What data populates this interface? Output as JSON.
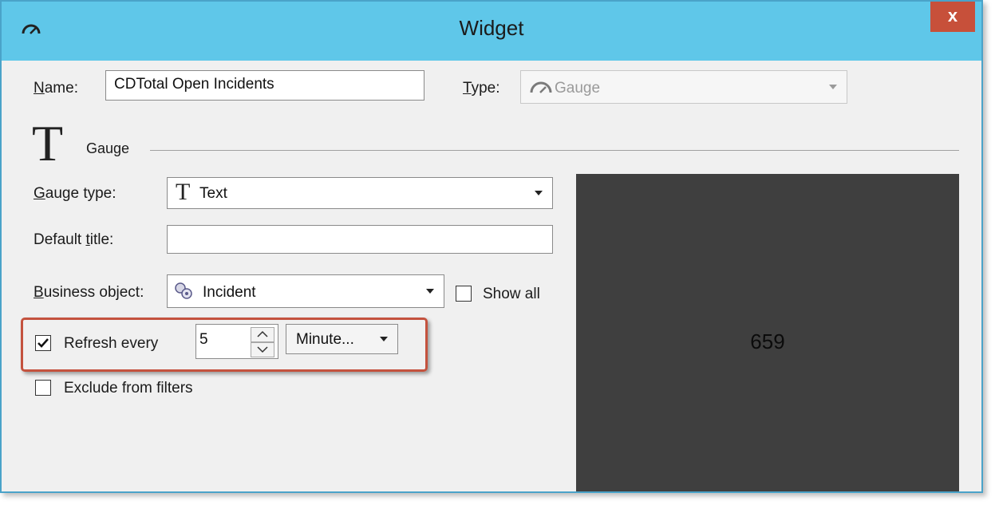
{
  "window": {
    "title": "Widget",
    "close_label": "x"
  },
  "name_field": {
    "label_key": "N",
    "label_rest": "ame:",
    "value": "CDTotal Open Incidents"
  },
  "type_field": {
    "label_key": "T",
    "label_rest": "ype:",
    "value": "Gauge",
    "disabled": true
  },
  "section": {
    "icon_glyph": "T",
    "title": "Gauge"
  },
  "gauge_type": {
    "label_key": "G",
    "label_rest": "auge type:",
    "icon_glyph": "T",
    "value": "Text"
  },
  "default_title": {
    "label_pre": "Default ",
    "label_key": "t",
    "label_rest": "itle:",
    "value": ""
  },
  "business_object": {
    "label_key": "B",
    "label_rest": "usiness object:",
    "value": "Incident"
  },
  "show_all": {
    "label": "Show all",
    "checked": false
  },
  "refresh": {
    "label": "Refresh every",
    "checked": true,
    "value": "5",
    "unit": "Minute..."
  },
  "exclude_filters": {
    "label": "Exclude from filters",
    "checked": false
  },
  "preview": {
    "value": "659"
  },
  "colors": {
    "titlebar": "#5fc7e9",
    "close": "#c7503a",
    "highlight": "#c4523e",
    "preview_bg": "#3f3f3f"
  },
  "icons": [
    "gauge-icon",
    "close-icon",
    "text-gauge-icon",
    "business-object-icon",
    "checkmark-icon",
    "chevron-down-icon",
    "spin-up-icon",
    "spin-down-icon"
  ]
}
